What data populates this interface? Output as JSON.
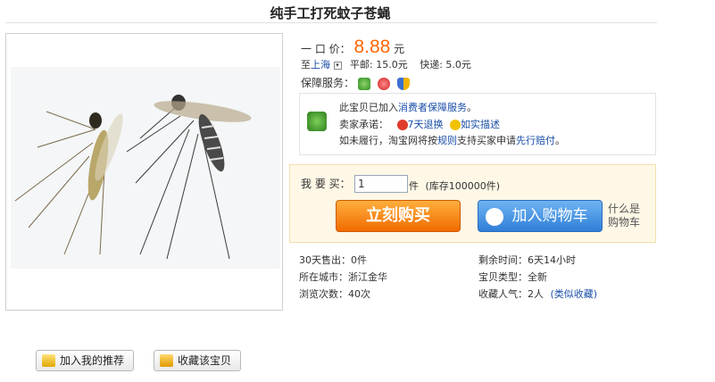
{
  "product": {
    "title": "纯手工打死蚊子苍蝇",
    "price_label": "一 口 价：",
    "price_value": "8.88",
    "price_unit": "元"
  },
  "shipping": {
    "to_label": "至",
    "destination": "上海",
    "post_text": "平邮: 15.0元",
    "express_text": "快递: 5.0元"
  },
  "service": {
    "label": "保障服务：",
    "line1_pre": "此宝贝已加入",
    "line1_link": "消费者保障服务",
    "line1_post": "。",
    "line2_label": "卖家承诺：",
    "line2_refund": "7天退换",
    "line2_asdesc": "如实描述",
    "line3_pre": "如未履行，淘宝网将按",
    "line3_rule": "规则",
    "line3_mid": "支持买家申请",
    "line3_claim": "先行赔付",
    "line3_post": "。"
  },
  "purchase": {
    "label": "我 要 买：",
    "quantity": "1",
    "unit": "件",
    "stock": "(库存100000件)",
    "buy_now": "立刻购买",
    "add_cart": "加入购物车",
    "what_line1": "什么是",
    "what_line2": "购物车"
  },
  "stats": {
    "sold_30": "30天售出：0件",
    "remaining": "剩余时间：6天14小时",
    "city": "所在城市：浙江金华",
    "category": "宝贝类型：全新",
    "views": "浏览次数：40次",
    "favorites": "收藏人气：2人",
    "similar": "(类似收藏)"
  },
  "actions": {
    "recommend": "加入我的推荐",
    "favorite": "收藏该宝贝"
  },
  "colors": {
    "price": "#ff6600",
    "link": "#1a4ea8",
    "buy_button": "#f06b00",
    "cart_button": "#2f7fd8"
  }
}
